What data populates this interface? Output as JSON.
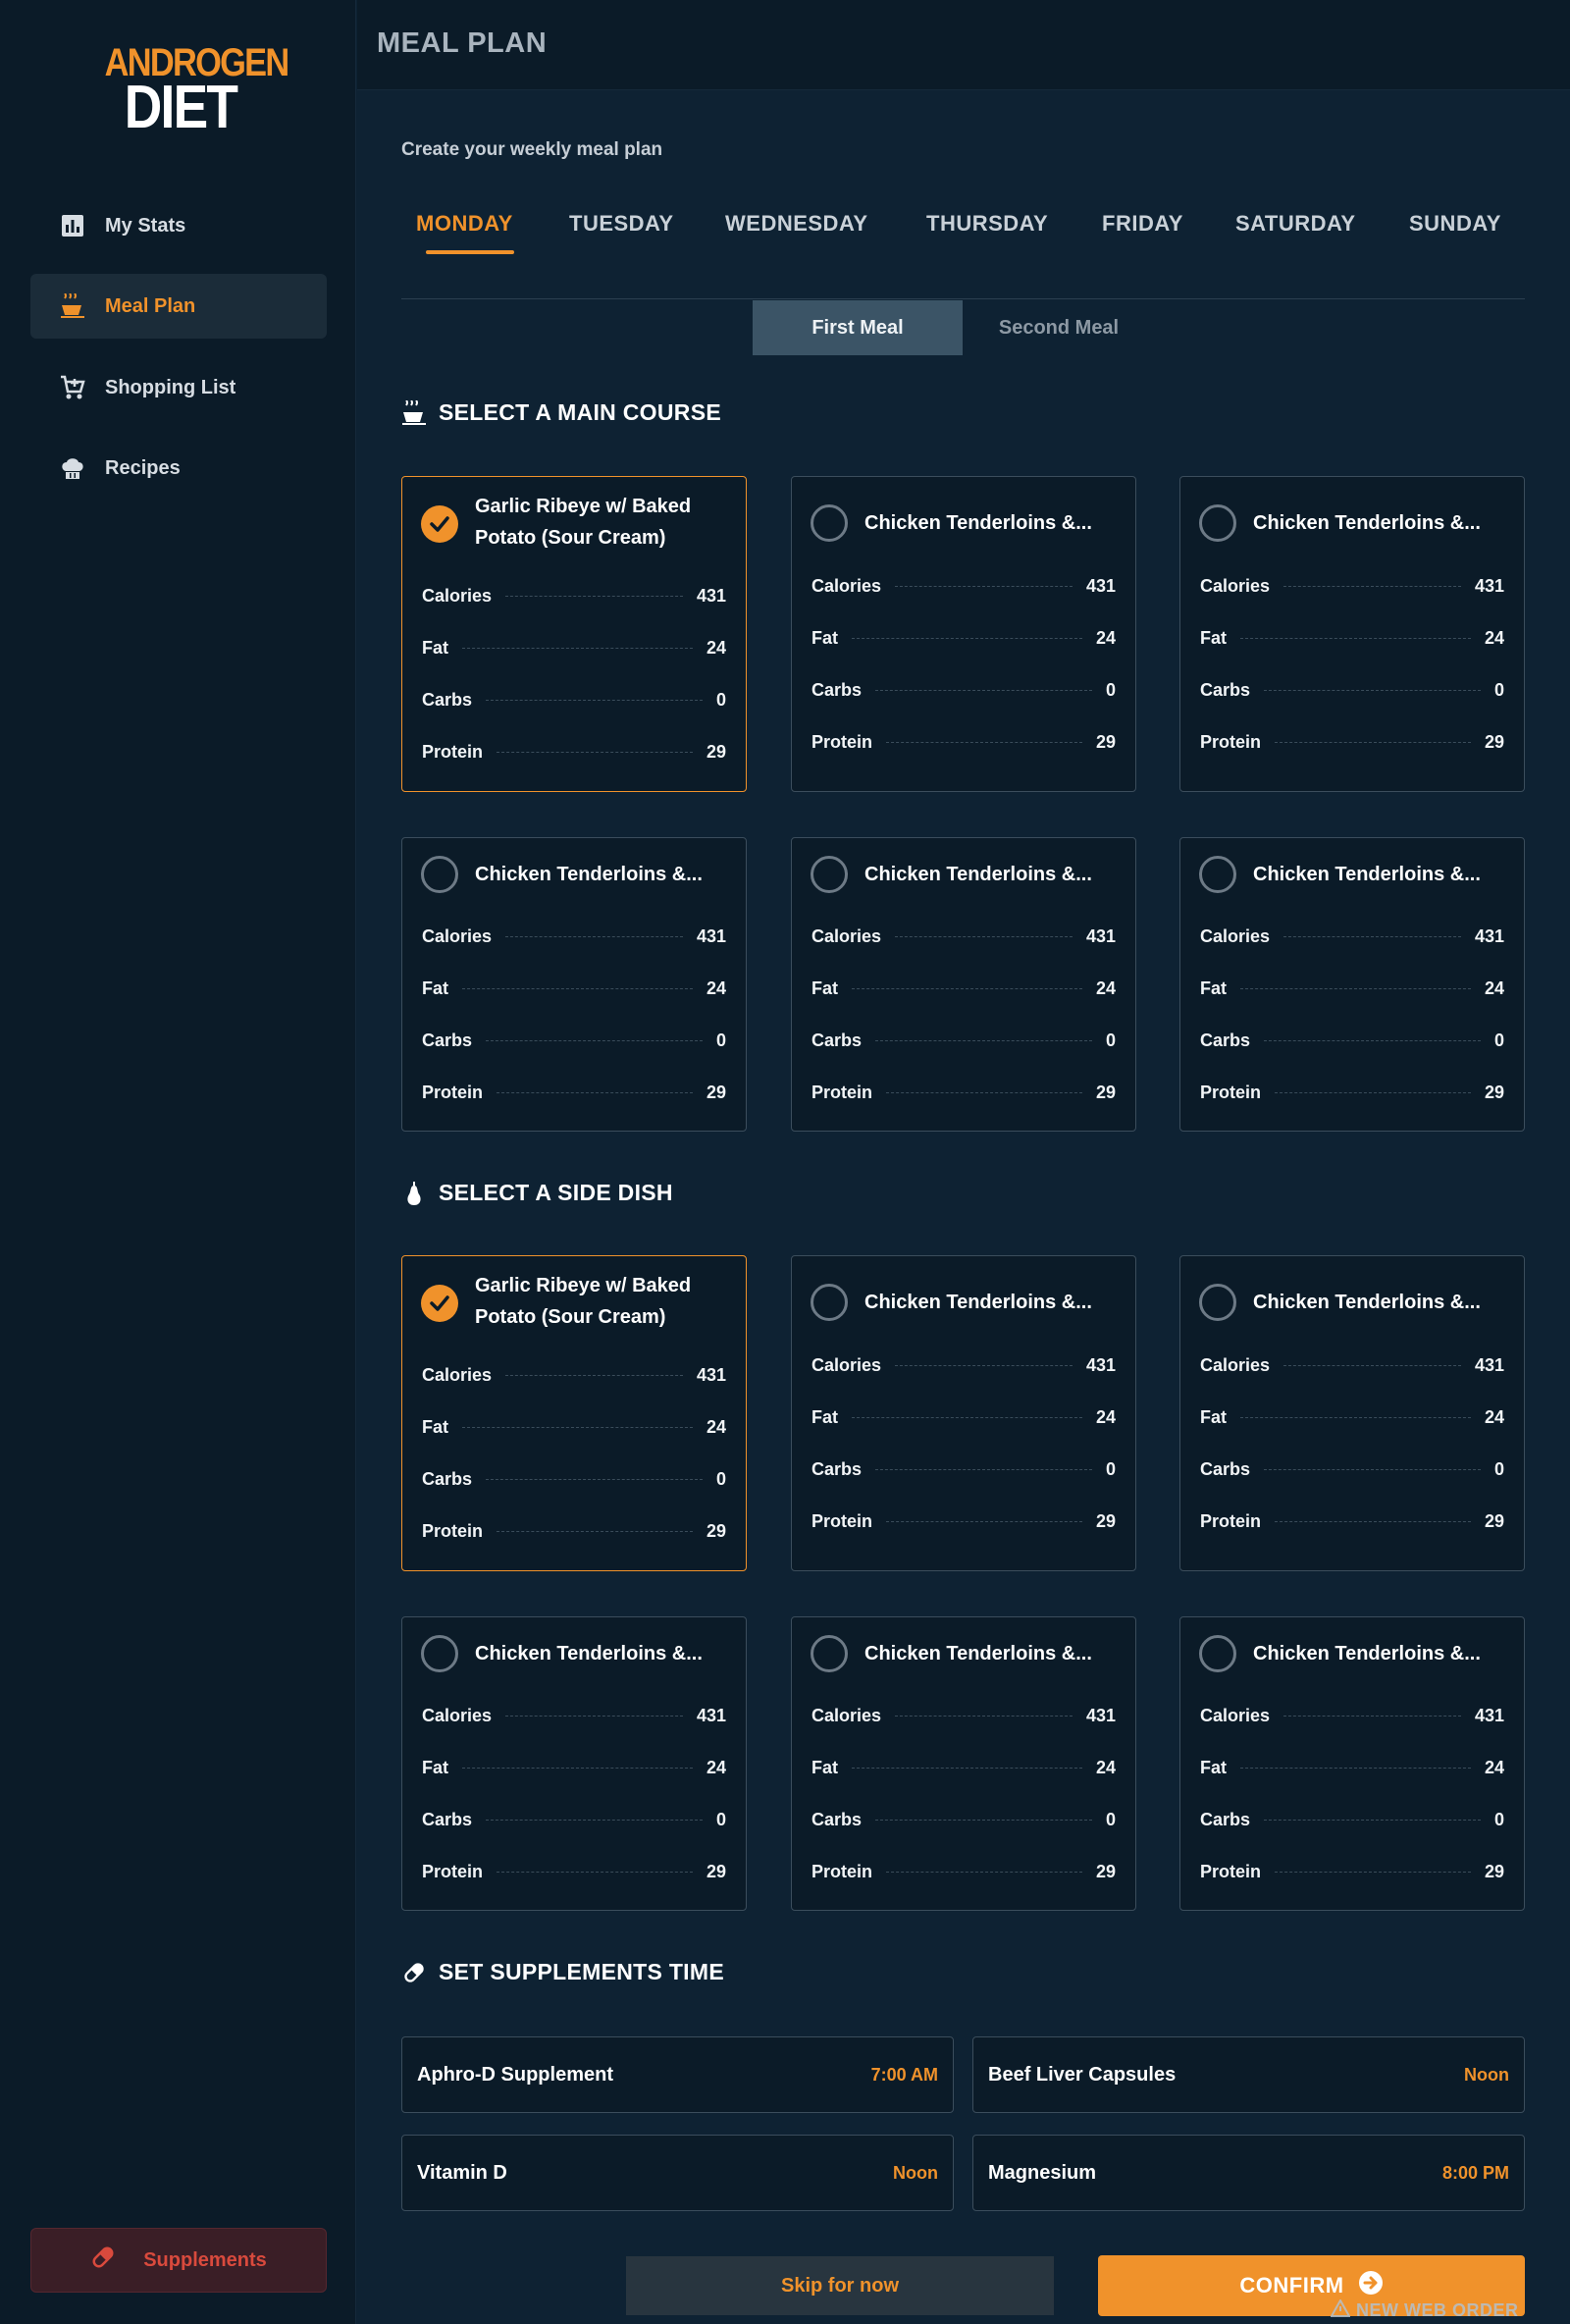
{
  "logo": {
    "line1": "ANDROGEN",
    "line2": "DIET"
  },
  "sidebar": {
    "items": [
      {
        "label": "My Stats",
        "icon": "bar-chart-icon",
        "active": false
      },
      {
        "label": "Meal Plan",
        "icon": "cooking-icon",
        "active": true
      },
      {
        "label": "Shopping List",
        "icon": "cart-icon",
        "active": false
      },
      {
        "label": "Recipes",
        "icon": "chef-hat-icon",
        "active": false
      }
    ],
    "supplements_label": "Supplements"
  },
  "header": {
    "title": "MEAL PLAN"
  },
  "subtitle": "Create your weekly meal plan",
  "days": [
    "MONDAY",
    "TUESDAY",
    "WEDNESDAY",
    "THURSDAY",
    "FRIDAY",
    "SATURDAY",
    "SUNDAY"
  ],
  "selected_day": "MONDAY",
  "meals": {
    "first": "First Meal",
    "second": "Second Meal",
    "selected": "First Meal"
  },
  "stat_labels": [
    "Calories",
    "Fat",
    "Carbs",
    "Protein"
  ],
  "main_course": {
    "title": "SELECT A MAIN COURSE",
    "cards": [
      {
        "title_line1": "Garlic Ribeye w/ Baked",
        "title_line2": "Potato (Sour Cream)",
        "selected": true,
        "values": [
          "431",
          "24",
          "0",
          "29"
        ]
      },
      {
        "title": "Chicken Tenderloins &...",
        "selected": false,
        "values": [
          "431",
          "24",
          "0",
          "29"
        ]
      },
      {
        "title": "Chicken Tenderloins &...",
        "selected": false,
        "values": [
          "431",
          "24",
          "0",
          "29"
        ]
      },
      {
        "title": "Chicken Tenderloins &...",
        "selected": false,
        "values": [
          "431",
          "24",
          "0",
          "29"
        ]
      },
      {
        "title": "Chicken Tenderloins &...",
        "selected": false,
        "values": [
          "431",
          "24",
          "0",
          "29"
        ]
      },
      {
        "title": "Chicken Tenderloins &...",
        "selected": false,
        "values": [
          "431",
          "24",
          "0",
          "29"
        ]
      }
    ]
  },
  "side_dish": {
    "title": "SELECT A SIDE DISH",
    "cards": [
      {
        "title_line1": "Garlic Ribeye w/ Baked",
        "title_line2": "Potato (Sour Cream)",
        "selected": true,
        "values": [
          "431",
          "24",
          "0",
          "29"
        ]
      },
      {
        "title": "Chicken Tenderloins &...",
        "selected": false,
        "values": [
          "431",
          "24",
          "0",
          "29"
        ]
      },
      {
        "title": "Chicken Tenderloins &...",
        "selected": false,
        "values": [
          "431",
          "24",
          "0",
          "29"
        ]
      },
      {
        "title": "Chicken Tenderloins &...",
        "selected": false,
        "values": [
          "431",
          "24",
          "0",
          "29"
        ]
      },
      {
        "title": "Chicken Tenderloins &...",
        "selected": false,
        "values": [
          "431",
          "24",
          "0",
          "29"
        ]
      },
      {
        "title": "Chicken Tenderloins &...",
        "selected": false,
        "values": [
          "431",
          "24",
          "0",
          "29"
        ]
      }
    ]
  },
  "supplements": {
    "title": "SET SUPPLEMENTS TIME",
    "items": [
      {
        "name": "Aphro-D Supplement",
        "time": "7:00 AM"
      },
      {
        "name": "Beef Liver Capsules",
        "time": "Noon"
      },
      {
        "name": "Vitamin D",
        "time": "Noon"
      },
      {
        "name": "Magnesium",
        "time": "8:00 PM"
      }
    ]
  },
  "footer": {
    "skip_label": "Skip for now",
    "confirm_label": "CONFIRM"
  },
  "watermark": "NEW WEB ORDER",
  "colors": {
    "accent": "#f0922b",
    "background": "#0e2233",
    "panel": "#0b1b28",
    "danger": "#d94a3d"
  }
}
